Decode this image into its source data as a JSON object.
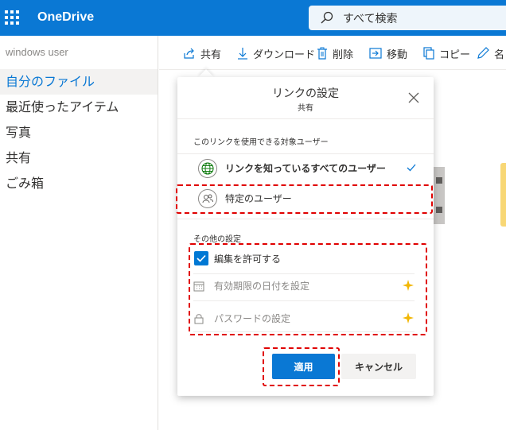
{
  "header": {
    "app_name": "OneDrive",
    "search_placeholder": "すべて検索"
  },
  "sidebar": {
    "user": "windows user",
    "items": [
      {
        "label": "自分のファイル",
        "selected": true
      },
      {
        "label": "最近使ったアイテム"
      },
      {
        "label": "写真"
      },
      {
        "label": "共有"
      },
      {
        "label": "ごみ箱"
      }
    ]
  },
  "toolbar": {
    "share": "共有",
    "download": "ダウンロード",
    "delete": "削除",
    "move": "移動",
    "copy": "コピー",
    "rename": "名"
  },
  "dialog": {
    "title": "リンクの設定",
    "subtitle": "共有",
    "audience_label": "このリンクを使用できる対象ユーザー",
    "options": [
      {
        "label": "リンクを知っているすべてのユーザー",
        "selected": true
      },
      {
        "label": "特定のユーザー",
        "selected": false
      }
    ],
    "other_settings_label": "その他の設定",
    "settings": [
      {
        "label": "編集を許可する",
        "checked": true
      },
      {
        "label": "有効期限の日付を設定",
        "premium": true
      },
      {
        "label": "パスワードの設定",
        "premium": true
      }
    ],
    "apply_label": "適用",
    "cancel_label": "キャンセル"
  },
  "colors": {
    "accent": "#0a78d4",
    "highlight": "#e00000",
    "premium": "#f2b705"
  }
}
